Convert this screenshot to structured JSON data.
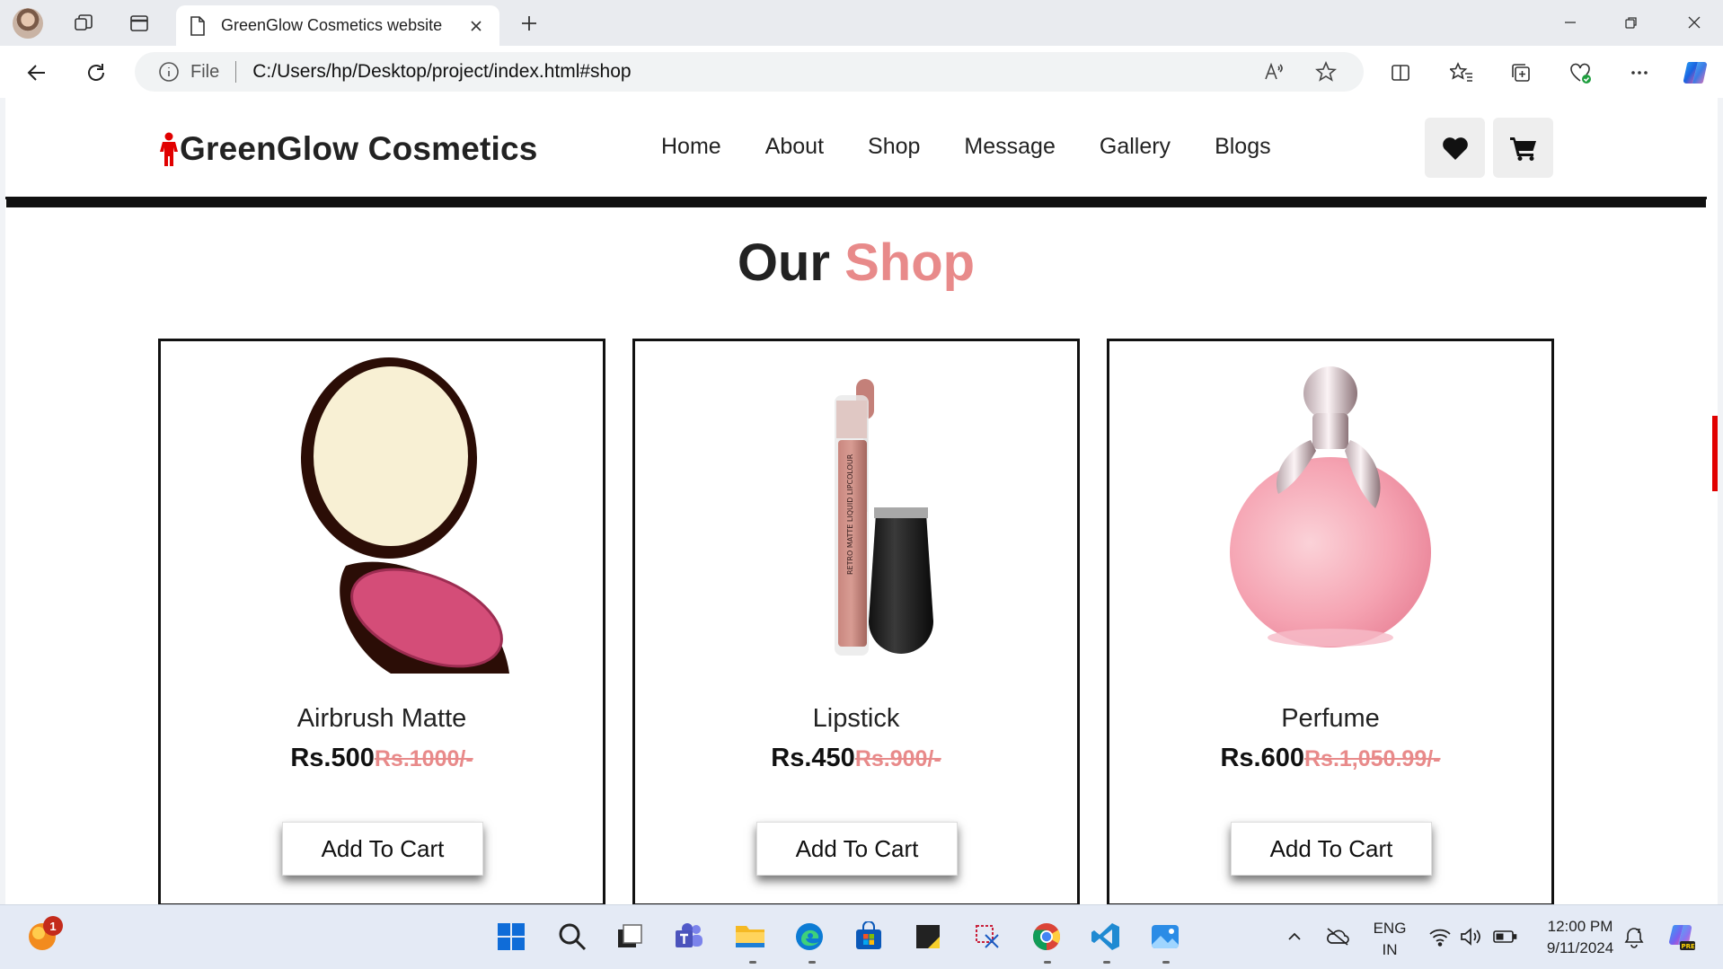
{
  "browser": {
    "tab_title": "GreenGlow Cosmetics website",
    "address_label": "File",
    "url": "C:/Users/hp/Desktop/project/index.html#shop"
  },
  "site": {
    "logo_text": "GreenGlow Cosmetics",
    "nav": [
      "Home",
      "About",
      "Shop",
      "Message",
      "Gallery",
      "Blogs"
    ],
    "section_title_plain": "Our",
    "section_title_accent": "Shop",
    "accent_color": "#e88a8a",
    "products": [
      {
        "name": "Airbrush Matte",
        "price": "Rs.500",
        "old_price": "Rs.1000/-",
        "button": "Add To Cart",
        "icon": "compact-powder-image"
      },
      {
        "name": "Lipstick",
        "price": "Rs.450",
        "old_price": "Rs.900/-",
        "button": "Add To Cart",
        "icon": "liquid-lipstick-image"
      },
      {
        "name": "Perfume",
        "price": "Rs.600",
        "old_price": "Rs.1,050.99/-",
        "button": "Add To Cart",
        "icon": "perfume-bottle-image"
      }
    ]
  },
  "taskbar": {
    "notification_count": "1",
    "language": "ENG",
    "region": "IN",
    "time": "12:00 PM",
    "date": "9/11/2024"
  }
}
